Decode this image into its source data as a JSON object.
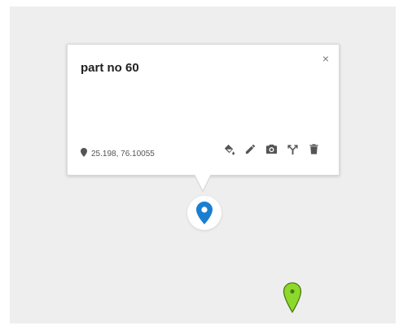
{
  "info_window": {
    "title": "part no 60",
    "close_label": "×",
    "coordinates": "25.198, 76.10055",
    "actions": [
      {
        "icon": "paint-bucket-icon"
      },
      {
        "icon": "pencil-icon"
      },
      {
        "icon": "camera-icon"
      },
      {
        "icon": "route-split-icon"
      },
      {
        "icon": "trash-icon"
      }
    ]
  },
  "markers": [
    {
      "icon": "blue-map-pin-icon",
      "color": "#1a7fd0",
      "selected": true
    },
    {
      "icon": "green-map-pin-icon",
      "color": "#8dd92b",
      "selected": false
    }
  ],
  "colors": {
    "map_background": "#efeeee",
    "icon_gray": "#555555"
  }
}
